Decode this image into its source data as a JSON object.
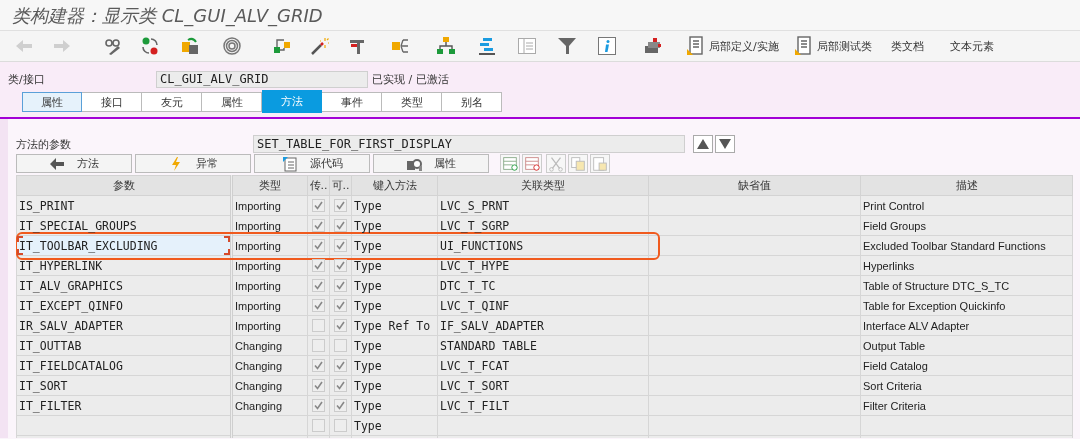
{
  "window": {
    "title": "类构建器：显示类 CL_GUI_ALV_GRID"
  },
  "toolbar": {
    "buttons": [
      {
        "label": "局部定义/实施",
        "kind": "icon-text"
      },
      {
        "label": "局部测试类",
        "kind": "icon-text"
      },
      {
        "label": "类文档",
        "kind": "text"
      },
      {
        "label": "文本元素",
        "kind": "text"
      }
    ]
  },
  "class_field": {
    "label": "类/接口",
    "value": "CL_GUI_ALV_GRID",
    "status": "已实现 / 已激活"
  },
  "tabs": [
    {
      "label": "属性",
      "selected": false,
      "focused": true
    },
    {
      "label": "接口",
      "selected": false,
      "focused": false
    },
    {
      "label": "友元",
      "selected": false,
      "focused": false
    },
    {
      "label": "属性",
      "selected": false,
      "focused": false
    },
    {
      "label": "方法",
      "selected": true,
      "focused": false
    },
    {
      "label": "事件",
      "selected": false,
      "focused": false
    },
    {
      "label": "类型",
      "selected": false,
      "focused": false
    },
    {
      "label": "别名",
      "selected": false,
      "focused": false
    }
  ],
  "method_field": {
    "label": "方法的参数",
    "value": "SET_TABLE_FOR_FIRST_DISPLAY"
  },
  "method_buttons": [
    {
      "label": "方法",
      "kind": "back"
    },
    {
      "label": "异常",
      "kind": "exception"
    },
    {
      "label": "源代码",
      "kind": "source"
    },
    {
      "label": "属性",
      "kind": "attributes"
    }
  ],
  "table": {
    "columns": [
      "参数",
      "类型",
      "传..",
      "可..",
      "键入方法",
      "关联类型",
      "缺省值",
      "描述"
    ],
    "rows": [
      {
        "parameter": "IS_PRINT",
        "type": "Importing",
        "pass_value": true,
        "optional": true,
        "typing": "Type",
        "associated_type": "LVC_S_PRNT",
        "description": "Print Control",
        "selected": false,
        "annotated": false
      },
      {
        "parameter": "IT_SPECIAL_GROUPS",
        "type": "Importing",
        "pass_value": true,
        "optional": true,
        "typing": "Type",
        "associated_type": "LVC_T_SGRP",
        "description": "Field Groups",
        "selected": false,
        "annotated": false
      },
      {
        "parameter": "IT_TOOLBAR_EXCLUDING",
        "type": "Importing",
        "pass_value": true,
        "optional": true,
        "typing": "Type",
        "associated_type": "UI_FUNCTIONS",
        "description": "Excluded Toolbar Standard Functions",
        "selected": true,
        "annotated": true
      },
      {
        "parameter": "IT_HYPERLINK",
        "type": "Importing",
        "pass_value": true,
        "optional": true,
        "typing": "Type",
        "associated_type": "LVC_T_HYPE",
        "description": "Hyperlinks",
        "selected": false,
        "annotated": false
      },
      {
        "parameter": "IT_ALV_GRAPHICS",
        "type": "Importing",
        "pass_value": true,
        "optional": true,
        "typing": "Type",
        "associated_type": "DTC_T_TC",
        "description": "Table of Structure DTC_S_TC",
        "selected": false,
        "annotated": false
      },
      {
        "parameter": "IT_EXCEPT_QINFO",
        "type": "Importing",
        "pass_value": true,
        "optional": true,
        "typing": "Type",
        "associated_type": "LVC_T_QINF",
        "description": "Table for Exception Quickinfo",
        "selected": false,
        "annotated": false
      },
      {
        "parameter": "IR_SALV_ADAPTER",
        "type": "Importing",
        "pass_value": false,
        "optional": true,
        "typing": "Type Ref To",
        "associated_type": "IF_SALV_ADAPTER",
        "description": "Interface ALV Adapter",
        "selected": false,
        "annotated": false
      },
      {
        "parameter": "IT_OUTTAB",
        "type": "Changing",
        "pass_value": false,
        "optional": false,
        "typing": "Type",
        "associated_type": "STANDARD TABLE",
        "description": "Output Table",
        "selected": false,
        "annotated": false
      },
      {
        "parameter": "IT_FIELDCATALOG",
        "type": "Changing",
        "pass_value": true,
        "optional": true,
        "typing": "Type",
        "associated_type": "LVC_T_FCAT",
        "description": "Field Catalog",
        "selected": false,
        "annotated": false
      },
      {
        "parameter": "IT_SORT",
        "type": "Changing",
        "pass_value": true,
        "optional": true,
        "typing": "Type",
        "associated_type": "LVC_T_SORT",
        "description": "Sort Criteria",
        "selected": false,
        "annotated": false
      },
      {
        "parameter": "IT_FILTER",
        "type": "Changing",
        "pass_value": true,
        "optional": true,
        "typing": "Type",
        "associated_type": "LVC_T_FILT",
        "description": "Filter Criteria",
        "selected": false,
        "annotated": false
      },
      {
        "pass_value": false,
        "optional": false,
        "typing": "Type",
        "selected": false,
        "annotated": false
      }
    ]
  }
}
